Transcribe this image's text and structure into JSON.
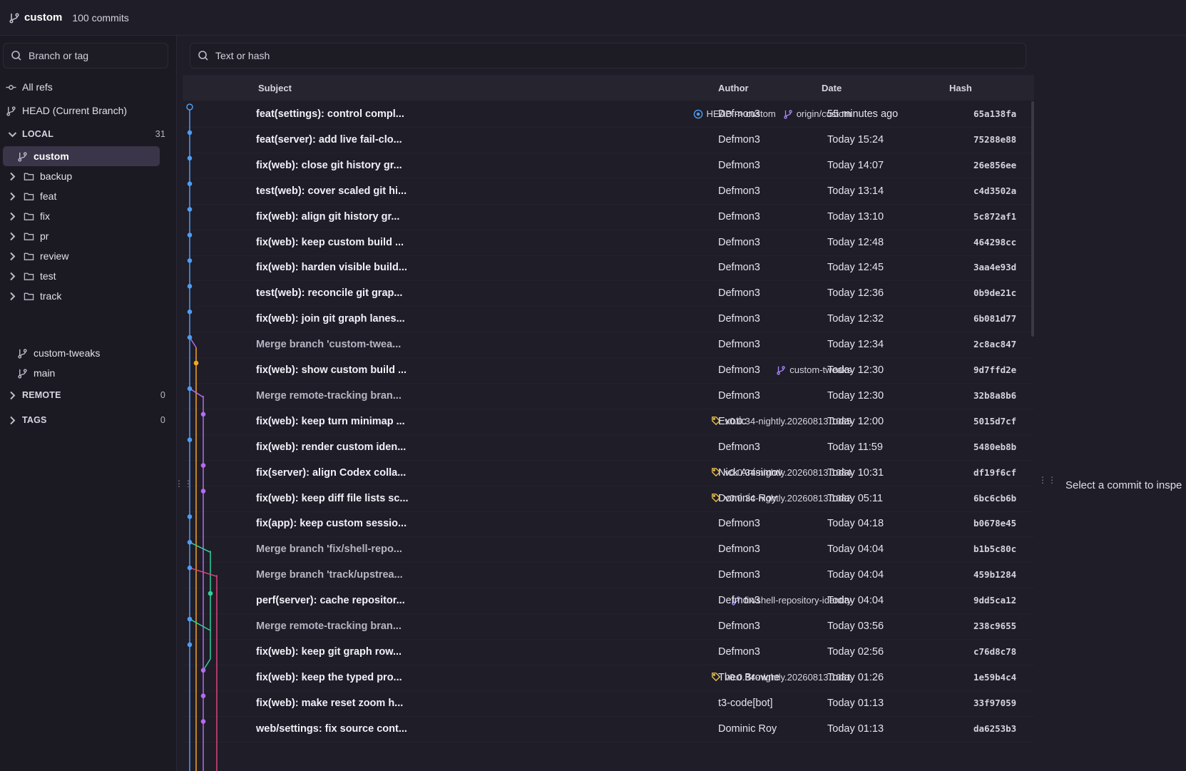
{
  "header": {
    "branch": "custom",
    "commit_count": "100 commits",
    "branch_icon": "git-branch-icon"
  },
  "sidebar": {
    "search_placeholder": "Branch or tag",
    "all_refs": "All refs",
    "head": "HEAD (Current Branch)",
    "local": {
      "label": "LOCAL",
      "count": "31"
    },
    "current_branch": "custom",
    "folders": [
      "backup",
      "feat",
      "fix",
      "pr",
      "review",
      "test",
      "track"
    ],
    "branches": [
      "custom-tweaks",
      "main"
    ],
    "remote": {
      "label": "REMOTE",
      "count": "0"
    },
    "tags": {
      "label": "TAGS",
      "count": "0"
    }
  },
  "main": {
    "search_placeholder": "Text or hash",
    "columns": {
      "subject": "Subject",
      "author": "Author",
      "date": "Date",
      "hash": "Hash"
    },
    "rows": [
      {
        "subject": "feat(settings): control compl...",
        "author": "Defmon3",
        "date": "55 minutes ago",
        "hash": "65a138fa",
        "refs": [
          {
            "type": "head",
            "text": "HEAD -> custom"
          },
          {
            "type": "branch",
            "text": "origin/custom"
          }
        ]
      },
      {
        "subject": "feat(server): add live fail-clo...",
        "author": "Defmon3",
        "date": "Today 15:24",
        "hash": "75288e88",
        "refs": []
      },
      {
        "subject": "fix(web): close git history gr...",
        "author": "Defmon3",
        "date": "Today 14:07",
        "hash": "26e856ee",
        "refs": []
      },
      {
        "subject": "test(web): cover scaled git hi...",
        "author": "Defmon3",
        "date": "Today 13:14",
        "hash": "c4d3502a",
        "refs": []
      },
      {
        "subject": "fix(web): align git history gr...",
        "author": "Defmon3",
        "date": "Today 13:10",
        "hash": "5c872af1",
        "refs": []
      },
      {
        "subject": "fix(web): keep custom build ...",
        "author": "Defmon3",
        "date": "Today 12:48",
        "hash": "464298cc",
        "refs": []
      },
      {
        "subject": "fix(web): harden visible build...",
        "author": "Defmon3",
        "date": "Today 12:45",
        "hash": "3aa4e93d",
        "refs": []
      },
      {
        "subject": "test(web): reconcile git grap...",
        "author": "Defmon3",
        "date": "Today 12:36",
        "hash": "0b9de21c",
        "refs": []
      },
      {
        "subject": "fix(web): join git graph lanes...",
        "author": "Defmon3",
        "date": "Today 12:32",
        "hash": "6b081d77",
        "refs": []
      },
      {
        "subject": "Merge branch 'custom-twea...",
        "author": "Defmon3",
        "date": "Today 12:34",
        "hash": "2c8ac847",
        "refs": [],
        "merge": true
      },
      {
        "subject": "fix(web): show custom build ...",
        "author": "Defmon3",
        "date": "Today 12:30",
        "hash": "9d7ffd2e",
        "refs": [
          {
            "type": "branch",
            "text": "custom-tweaks"
          }
        ]
      },
      {
        "subject": "Merge remote-tracking bran...",
        "author": "Defmon3",
        "date": "Today 12:30",
        "hash": "32b8a8b6",
        "refs": [],
        "merge": true
      },
      {
        "subject": "fix(web): keep turn minimap ...",
        "author": "Exotic",
        "date": "Today 12:00",
        "hash": "5015d7cf",
        "refs": [
          {
            "type": "tag",
            "text": "v0.0.34-nightly.20260813.1085"
          }
        ]
      },
      {
        "subject": "fix(web): render custom iden...",
        "author": "Defmon3",
        "date": "Today 11:59",
        "hash": "5480eb8b",
        "refs": []
      },
      {
        "subject": "fix(server): align Codex colla...",
        "author": "Nick Anisimov",
        "date": "Today 10:31",
        "hash": "df19f6cf",
        "refs": [
          {
            "type": "tag",
            "text": "v0.0.34-nightly.20260813.1084"
          }
        ]
      },
      {
        "subject": "fix(web): keep diff file lists sc...",
        "author": "Dominic Roy",
        "date": "Today 05:11",
        "hash": "6bc6cb6b",
        "refs": [
          {
            "type": "tag",
            "text": "v0.0.34-nightly.20260813.1082"
          }
        ]
      },
      {
        "subject": "fix(app): keep custom sessio...",
        "author": "Defmon3",
        "date": "Today 04:18",
        "hash": "b0678e45",
        "refs": []
      },
      {
        "subject": "Merge branch 'fix/shell-repo...",
        "author": "Defmon3",
        "date": "Today 04:04",
        "hash": "b1b5c80c",
        "refs": [],
        "merge": true
      },
      {
        "subject": "Merge branch 'track/upstrea...",
        "author": "Defmon3",
        "date": "Today 04:04",
        "hash": "459b1284",
        "refs": [],
        "merge": true
      },
      {
        "subject": "perf(server): cache repositor...",
        "author": "Defmon3",
        "date": "Today 04:04",
        "hash": "9dd5ca12",
        "refs": [
          {
            "type": "branch",
            "text": "fix/shell-repository-identity"
          }
        ]
      },
      {
        "subject": "Merge remote-tracking bran...",
        "author": "Defmon3",
        "date": "Today 03:56",
        "hash": "238c9655",
        "refs": [],
        "merge": true
      },
      {
        "subject": "fix(web): keep git graph row...",
        "author": "Defmon3",
        "date": "Today 02:56",
        "hash": "c76d8c78",
        "refs": []
      },
      {
        "subject": "fix(web): keep the typed pro...",
        "author": "Theo Browne",
        "date": "Today 01:26",
        "hash": "1e59b4c4",
        "refs": [
          {
            "type": "tag",
            "text": "v0.0.34-nightly.20260813.1081"
          }
        ]
      },
      {
        "subject": "fix(web): make reset zoom h...",
        "author": "t3-code[bot]",
        "date": "Today 01:13",
        "hash": "33f97059",
        "refs": []
      },
      {
        "subject": "web/settings: fix source cont...",
        "author": "Dominic Roy",
        "date": "Today 01:13",
        "hash": "da6253b3",
        "refs": []
      }
    ]
  },
  "detail": {
    "empty_text": "Select a commit to inspe"
  },
  "colors": {
    "lane_blue": "#4f9cf0",
    "lane_orange": "#f5a524",
    "lane_purple": "#b46cf0",
    "lane_green": "#2fd19a",
    "lane_pink": "#e0457b",
    "tag_yellow": "#f2c94c",
    "branch_purple": "#a78bfa",
    "head_blue": "#4f9cf0"
  },
  "graph": {
    "dots": [
      {
        "row": 0,
        "lane": 0,
        "color": "blue",
        "hollow": true
      },
      {
        "row": 1,
        "lane": 0,
        "color": "blue"
      },
      {
        "row": 2,
        "lane": 0,
        "color": "blue"
      },
      {
        "row": 3,
        "lane": 0,
        "color": "blue"
      },
      {
        "row": 4,
        "lane": 0,
        "color": "blue"
      },
      {
        "row": 5,
        "lane": 0,
        "color": "blue"
      },
      {
        "row": 6,
        "lane": 0,
        "color": "blue"
      },
      {
        "row": 7,
        "lane": 0,
        "color": "blue"
      },
      {
        "row": 8,
        "lane": 0,
        "color": "blue"
      },
      {
        "row": 9,
        "lane": 0,
        "color": "blue"
      },
      {
        "row": 10,
        "lane": 1,
        "color": "orange"
      },
      {
        "row": 11,
        "lane": 0,
        "color": "blue"
      },
      {
        "row": 12,
        "lane": 2,
        "color": "purple"
      },
      {
        "row": 13,
        "lane": 0,
        "color": "blue"
      },
      {
        "row": 14,
        "lane": 2,
        "color": "purple"
      },
      {
        "row": 15,
        "lane": 2,
        "color": "purple"
      },
      {
        "row": 16,
        "lane": 0,
        "color": "blue"
      },
      {
        "row": 17,
        "lane": 0,
        "color": "blue"
      },
      {
        "row": 18,
        "lane": 0,
        "color": "blue"
      },
      {
        "row": 19,
        "lane": 3,
        "color": "green"
      },
      {
        "row": 20,
        "lane": 0,
        "color": "blue"
      },
      {
        "row": 21,
        "lane": 0,
        "color": "blue"
      },
      {
        "row": 22,
        "lane": 2,
        "color": "purple"
      },
      {
        "row": 23,
        "lane": 2,
        "color": "purple"
      },
      {
        "row": 24,
        "lane": 2,
        "color": "purple"
      }
    ]
  }
}
